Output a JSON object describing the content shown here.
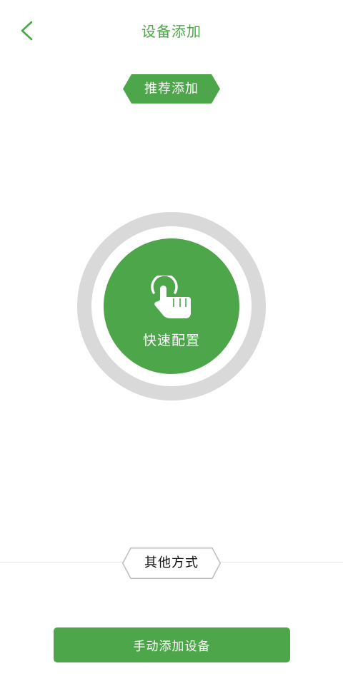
{
  "header": {
    "title": "设备添加",
    "back_icon": "chevron-left-icon"
  },
  "recommend": {
    "label": "推荐添加"
  },
  "quick_config": {
    "icon": "touch-hand-icon",
    "label": "快速配置"
  },
  "other": {
    "label": "其他方式"
  },
  "manual": {
    "label": "手动添加设备"
  },
  "colors": {
    "accent": "#4ea64a",
    "ring": "#d9d9d9",
    "divider": "#e6e6e6"
  }
}
